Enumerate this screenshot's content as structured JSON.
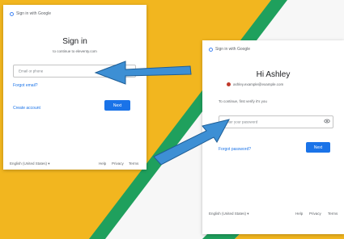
{
  "colors": {
    "background_yellow": "#f2b61f",
    "stripe_green": "#1fa05d",
    "accent_blue": "#1a73e8",
    "arrow_blue": "#3d8fd4"
  },
  "left_card": {
    "brand": "Sign in with Google",
    "title": "Sign in",
    "subtitle": "to continue to eleventy.com",
    "email_placeholder": "Email or phone",
    "forgot_email": "Forgot email?",
    "create_account": "Create account",
    "next_button": "Next",
    "footer_language": "English (United States)",
    "footer_help": "Help",
    "footer_privacy": "Privacy",
    "footer_terms": "Terms"
  },
  "right_card": {
    "brand": "Sign in with Google",
    "title": "Hi Ashley",
    "account_email": "ashley.example@example.com",
    "continue_text": "To continue, first verify it's you",
    "password_placeholder": "Enter your password",
    "forgot_password": "Forgot password?",
    "next_button": "Next",
    "footer_language": "English (United States)",
    "footer_help": "Help",
    "footer_privacy": "Privacy",
    "footer_terms": "Terms"
  },
  "icons": {
    "left_logo": "google-logo-icon",
    "right_logo": "google-logo-icon",
    "avatar": "avatar-icon",
    "eye": "eye-icon",
    "dropdown": "chevron-down-icon",
    "arrow_left": "arrow-left-icon",
    "arrow_right": "arrow-up-right-icon"
  }
}
